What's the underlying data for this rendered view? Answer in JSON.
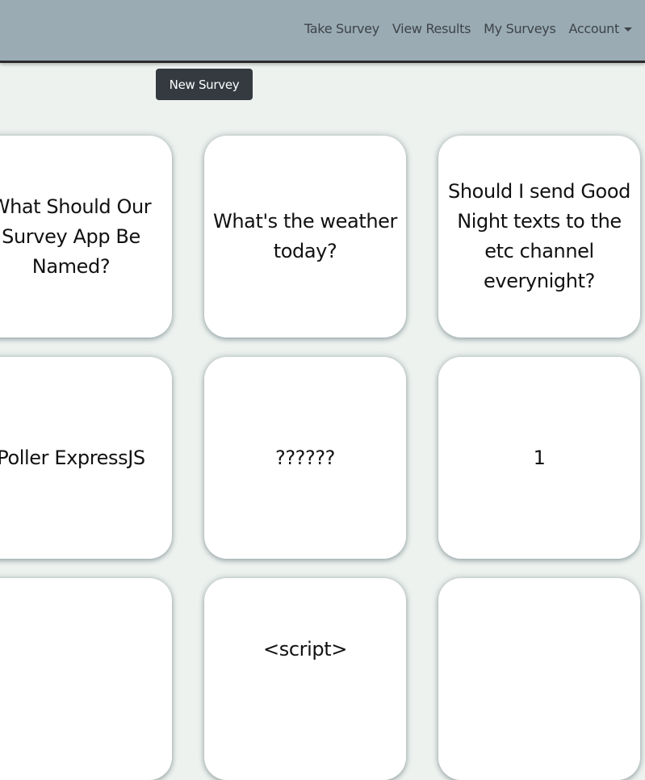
{
  "nav": {
    "links": [
      "Take Survey",
      "View Results",
      "My Surveys",
      "Account"
    ]
  },
  "toolbar": {
    "new_survey_label": "New Survey"
  },
  "surveys": [
    "What Should Our Survey App Be Named?",
    "What's the weather today?",
    "Should I send Good Night texts to the etc channel everynight?",
    "Poller ExpressJS",
    "??????",
    "1",
    "",
    "<script>",
    ""
  ]
}
